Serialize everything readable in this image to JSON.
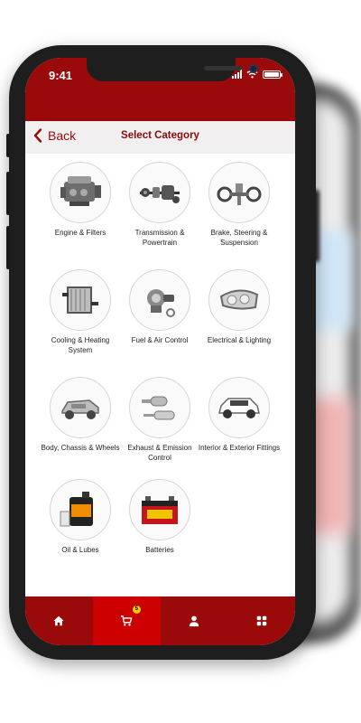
{
  "status": {
    "time": "9:41"
  },
  "header": {
    "back_label": "Back",
    "title": "Select Category"
  },
  "categories": [
    {
      "label": "Engine & Filters",
      "icon": "engine-icon"
    },
    {
      "label": "Transmission & Powertrain",
      "icon": "transmission-icon"
    },
    {
      "label": "Brake, Steering & Suspension",
      "icon": "brake-steering-icon"
    },
    {
      "label": "Cooling & Heating System",
      "icon": "radiator-icon"
    },
    {
      "label": "Fuel & Air Control",
      "icon": "fuel-pump-icon"
    },
    {
      "label": "Electrical & Lighting",
      "icon": "headlight-icon"
    },
    {
      "label": "Body, Chassis & Wheels",
      "icon": "car-body-icon"
    },
    {
      "label": "Exhaust & Emission Control",
      "icon": "exhaust-icon"
    },
    {
      "label": "Interior & Exterior Fittings",
      "icon": "suv-icon"
    },
    {
      "label": "Oil & Lubes",
      "icon": "oil-can-icon"
    },
    {
      "label": "Batteries",
      "icon": "battery-icon"
    }
  ],
  "tabbar": {
    "items": [
      {
        "name": "home",
        "icon": "home-icon"
      },
      {
        "name": "cart",
        "icon": "cart-icon",
        "badge": "5"
      },
      {
        "name": "profile",
        "icon": "user-icon"
      },
      {
        "name": "menu",
        "icon": "grid-icon"
      }
    ]
  },
  "colors": {
    "brand": "#9b0a0a",
    "active_tab": "#cc0000",
    "badge": "#f5d000"
  }
}
